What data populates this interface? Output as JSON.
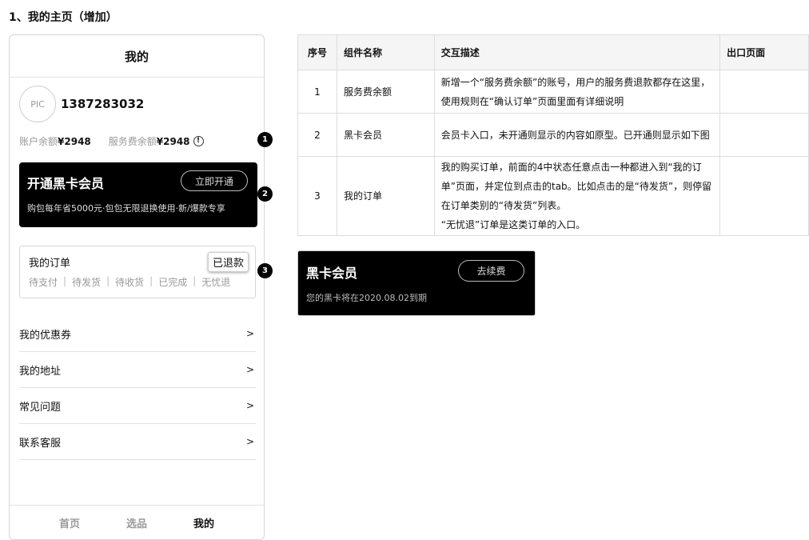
{
  "section_title": "1、我的主页（增加）",
  "phone": {
    "header_title": "我的",
    "avatar_text": "PIC",
    "phone_number": "1387283032",
    "balance": {
      "label": "账户余额",
      "value": "¥2948"
    },
    "service_balance": {
      "label": "服务费余额",
      "value": "¥2948",
      "icon": "info-circle-icon"
    },
    "black_card": {
      "title": "开通黑卡会员",
      "button": "立即开通",
      "desc": "购包每年省5000元·包包无限退换使用·新/爆款专享"
    },
    "orders": {
      "title": "我的订单",
      "refund_badge": "已退款",
      "tabs": [
        "待支付",
        "待发货",
        "待收货",
        "已完成",
        "无忧退"
      ],
      "separator": "|"
    },
    "menu": [
      {
        "label": "我的优惠券",
        "arrow": ">"
      },
      {
        "label": "我的地址",
        "arrow": ">"
      },
      {
        "label": "常见问题",
        "arrow": ">"
      },
      {
        "label": "联系客服",
        "arrow": ">"
      }
    ],
    "tabbar": [
      {
        "label": "首页",
        "active": false
      },
      {
        "label": "选品",
        "active": false
      },
      {
        "label": "我的",
        "active": true
      }
    ]
  },
  "markers": [
    "1",
    "2",
    "3"
  ],
  "spec_table": {
    "headers": [
      "序号",
      "组件名称",
      "交互描述",
      "出口页面"
    ],
    "rows": [
      {
        "no": "1",
        "name": "服务费余额",
        "desc": "新增一个“服务费余额”的账号，用户的服务费退款都存在这里，使用规则在“确认订单”页面里面有详细说明",
        "exit": ""
      },
      {
        "no": "2",
        "name": "黑卡会员",
        "desc": "会员卡入口，未开通则显示的内容如原型。已开通则显示如下图",
        "exit": ""
      },
      {
        "no": "3",
        "name": "我的订单",
        "desc": "我的购买订单，前面的4中状态任意点击一种都进入到“我的订单”页面，并定位到点击的tab。比如点击的是“待发货”，则停留在订单类别的“待发货”列表。",
        "desc_extra": "“无忧退”订单是这类订单的入口。",
        "exit": ""
      }
    ]
  },
  "renew_card": {
    "title": "黑卡会员",
    "button": "去续费",
    "desc": "您的黑卡将在2020.08.02到期"
  }
}
